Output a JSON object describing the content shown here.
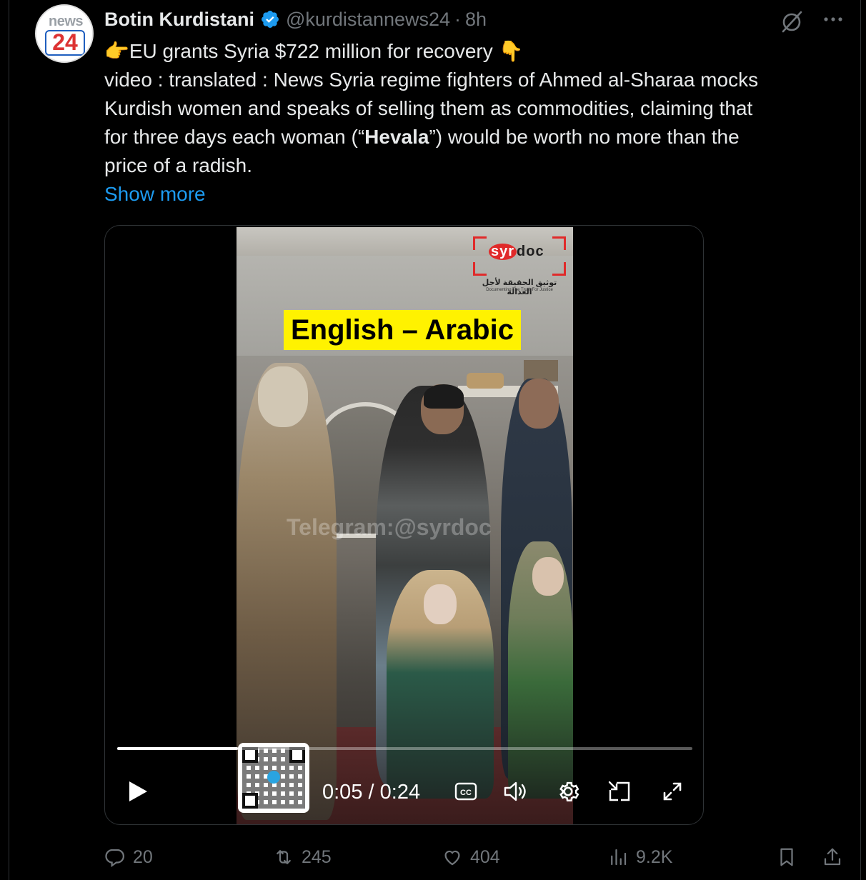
{
  "author": {
    "display_name": "Botin Kurdistani",
    "handle": "@kurdistannews24",
    "separator": "·",
    "time": "8h",
    "avatar_top_text": "news",
    "avatar_number": "24"
  },
  "tweet": {
    "line1": "👉EU grants Syria $722 million for recovery 👇",
    "line2": "video : translated : News Syria regime fighters of Ahmed al-Sharaa mocks",
    "line3": "Kurdish women and speaks of selling them as commodities, claiming that",
    "line4_a": "for three days each woman (“",
    "line4_bold": "Hevala",
    "line4_b": "”) would be worth no more than the",
    "line5": "price of a radish.",
    "show_more": "Show more"
  },
  "video": {
    "caption": "English – Arabic",
    "watermark": "Telegram:@syrdoc",
    "logo_syr": "syr",
    "logo_doc": "doc",
    "logo_arabic": "توثيق الحقيقة لأجل العدالة",
    "logo_english": "Documenting The Truth For Justice",
    "current_time": "0:05",
    "time_separator": "/",
    "duration": "0:24",
    "progress_fraction": 0.21,
    "cc_label": "CC"
  },
  "actions": {
    "replies": "20",
    "reposts": "245",
    "likes": "404",
    "views": "9.2K"
  },
  "colors": {
    "background": "#000000",
    "text": "#e7e9ea",
    "muted": "#71767b",
    "link": "#1d9bf0",
    "verified": "#1d9bf0",
    "caption_bg": "#fff200"
  }
}
